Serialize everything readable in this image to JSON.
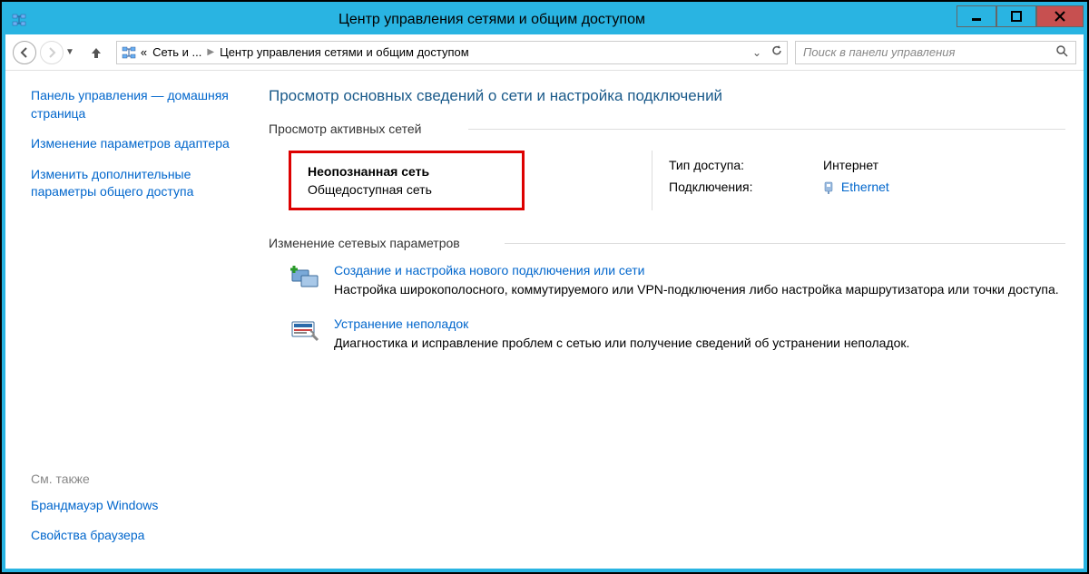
{
  "window": {
    "title": "Центр управления сетями и общим доступом"
  },
  "address": {
    "root_prefix": "«",
    "root": "Сеть и ...",
    "current": "Центр управления сетями и общим доступом"
  },
  "search": {
    "placeholder": "Поиск в панели управления"
  },
  "sidebar": {
    "home": "Панель управления — домашняя страница",
    "adapter": "Изменение параметров адаптера",
    "sharing": "Изменить дополнительные параметры общего доступа",
    "see_also_label": "См. также",
    "firewall": "Брандмауэр Windows",
    "browser": "Свойства браузера"
  },
  "main": {
    "heading": "Просмотр основных сведений о сети и настройка подключений",
    "active_networks_label": "Просмотр активных сетей",
    "network": {
      "name": "Неопознанная сеть",
      "type": "Общедоступная сеть",
      "access_label": "Тип доступа:",
      "access_value": "Интернет",
      "conn_label": "Подключения:",
      "conn_value": "Ethernet"
    },
    "change_settings_label": "Изменение сетевых параметров",
    "task1": {
      "title": "Создание и настройка нового подключения или сети",
      "desc": "Настройка широкополосного, коммутируемого или VPN-подключения либо настройка маршрутизатора или точки доступа."
    },
    "task2": {
      "title": "Устранение неполадок",
      "desc": "Диагностика и исправление проблем с сетью или получение сведений об устранении неполадок."
    }
  }
}
